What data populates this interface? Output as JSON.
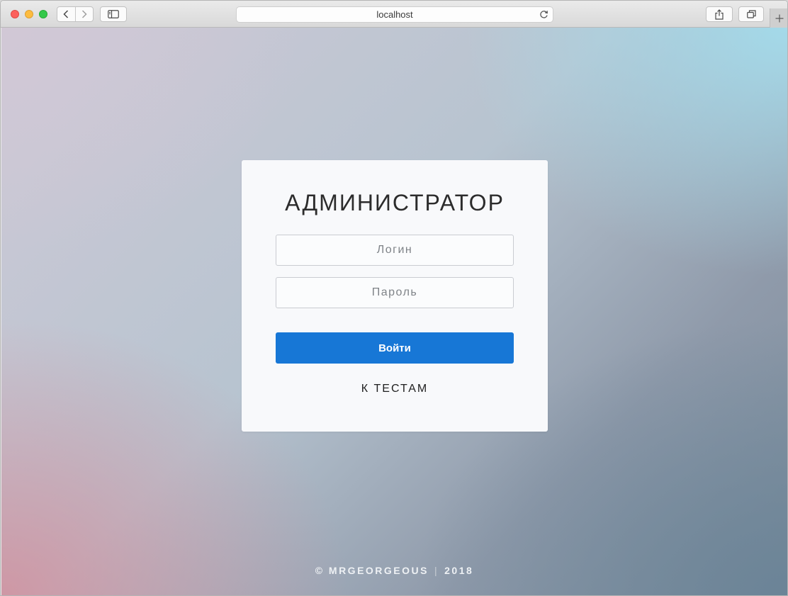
{
  "browser": {
    "url": "localhost",
    "icons": {
      "back": "chevron-left-icon",
      "forward": "chevron-right-icon",
      "sidebar": "sidebar-icon",
      "reload": "reload-icon",
      "share": "share-icon",
      "tabs": "tabs-overview-icon",
      "new_tab": "plus-icon"
    }
  },
  "login_card": {
    "title": "АДМИНИСТРАТОР",
    "login_placeholder": "Логин",
    "password_placeholder": "Пароль",
    "submit_label": "Войти",
    "to_tests_label": "К ТЕСТАМ"
  },
  "footer": {
    "author": "© MRGEORGEOUS",
    "separator": "|",
    "year": "2018"
  },
  "colors": {
    "accent": "#1777d6",
    "card_background": "#f8f9fb"
  }
}
